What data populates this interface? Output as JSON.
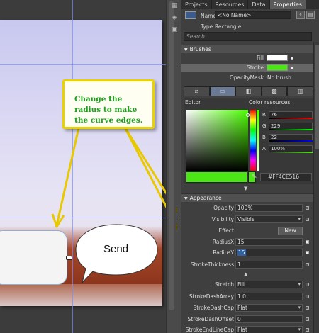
{
  "tabs": [
    "Projects",
    "Resources",
    "Data",
    "Properties"
  ],
  "active_tab": "Properties",
  "object": {
    "name_label": "Name",
    "name_value": "<No Name>",
    "type_label": "Type",
    "type_value": "Rectangle"
  },
  "search": {
    "placeholder": "Search"
  },
  "brushes": {
    "header": "Brushes",
    "fill_label": "Fill",
    "stroke_label": "Stroke",
    "opacity_mask_label": "OpacityMask",
    "opacity_mask_value": "No brush",
    "fill_color": "#ffffff",
    "stroke_color": "#4ce516"
  },
  "editor": {
    "label": "Editor",
    "color_resources": "Color resources",
    "r_label": "R",
    "r_value": "76",
    "g_label": "G",
    "g_value": "229",
    "b_label": "B",
    "b_value": "22",
    "a_label": "A",
    "a_value": "100%",
    "hex_value": "#FF4CE516"
  },
  "appearance": {
    "header": "Appearance",
    "rows": [
      {
        "label": "Opacity",
        "value": "100%"
      },
      {
        "label": "Visibility",
        "value": "Visible"
      },
      {
        "label": "Effect",
        "button": "New"
      },
      {
        "label": "RadiusX",
        "value": "15"
      },
      {
        "label": "RadiusY",
        "value": "15"
      },
      {
        "label": "StrokeThickness",
        "value": "1"
      }
    ]
  },
  "stroke_props": [
    {
      "label": "Stretch",
      "value": "Fill"
    },
    {
      "label": "StrokeDashArray",
      "value": "1 0"
    },
    {
      "label": "StrokeDashCap",
      "value": "Flat"
    },
    {
      "label": "StrokeDashOffset",
      "value": "0"
    },
    {
      "label": "StrokeEndLineCap",
      "value": "Flat"
    }
  ],
  "canvas": {
    "callout_text": "Change the radius to make the curve edges.",
    "speech_bubble_text": "Send"
  }
}
